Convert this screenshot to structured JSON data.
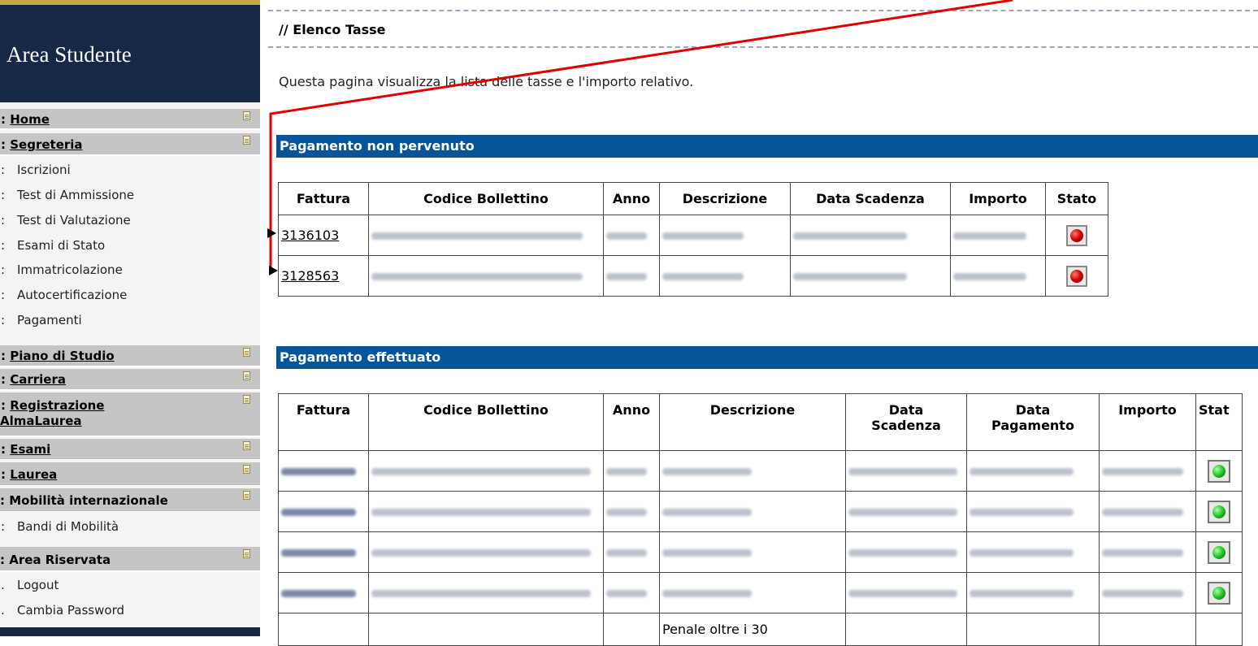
{
  "sidebar": {
    "title": "Area Studente",
    "sections": {
      "home": {
        "prefix": ":",
        "label": "Home"
      },
      "segreteria": {
        "prefix": ":",
        "label": "Segreteria"
      },
      "piano": {
        "prefix": ":",
        "label": "Piano di Studio"
      },
      "carriera": {
        "prefix": ":",
        "label": "Carriera"
      },
      "registrazione_1": {
        "prefix": ":",
        "label": "Registrazione"
      },
      "registrazione_2": {
        "label": "AlmaLaurea"
      },
      "esami": {
        "prefix": ":",
        "label": "Esami"
      },
      "laurea": {
        "prefix": ":",
        "label": "Laurea"
      },
      "mobilita": {
        "label": ": Mobilità internazionale"
      },
      "area_riservata": {
        "label": ": Area Riservata"
      }
    },
    "segreteria_items": [
      {
        "prefix": ":",
        "label": "Iscrizioni"
      },
      {
        "prefix": ":",
        "label": "Test di Ammissione"
      },
      {
        "prefix": ":",
        "label": "Test di Valutazione"
      },
      {
        "prefix": ":",
        "label": "Esami di Stato"
      },
      {
        "prefix": ":",
        "label": "Immatricolazione"
      },
      {
        "prefix": ":",
        "label": "Autocertificazione"
      },
      {
        "prefix": ":",
        "label": "Pagamenti"
      }
    ],
    "mobilita_items": [
      {
        "prefix": ":",
        "label": "Bandi di Mobilità"
      }
    ],
    "riservata_items": [
      {
        "prefix": ".",
        "label": "Logout"
      },
      {
        "prefix": ".",
        "label": "Cambia Password"
      }
    ]
  },
  "main": {
    "title": "// Elenco Tasse",
    "intro": "Questa pagina visualizza la lista delle tasse e l'importo relativo.",
    "non_pervenuto": {
      "heading": "Pagamento non pervenuto",
      "headers": [
        "Fattura",
        "Codice Bollettino",
        "Anno",
        "Descrizione",
        "Data Scadenza",
        "Importo",
        "Stato"
      ],
      "rows": [
        {
          "fattura": "3136103"
        },
        {
          "fattura": "3128563"
        }
      ]
    },
    "effettuato": {
      "heading": "Pagamento effettuato",
      "headers": {
        "fattura": "Fattura",
        "codice": "Codice Bollettino",
        "anno": "Anno",
        "descrizione": "Descrizione",
        "data_scadenza_1": "Data",
        "data_scadenza_2": "Scadenza",
        "data_pagamento_1": "Data",
        "data_pagamento_2": "Pagamento",
        "importo": "Importo",
        "stato": "Stat"
      },
      "note_partial": "Penale oltre i 30"
    }
  },
  "colors": {
    "sidebar_header": "#172846",
    "section_bar": "#05559a",
    "annotation_red": "#e00000"
  }
}
